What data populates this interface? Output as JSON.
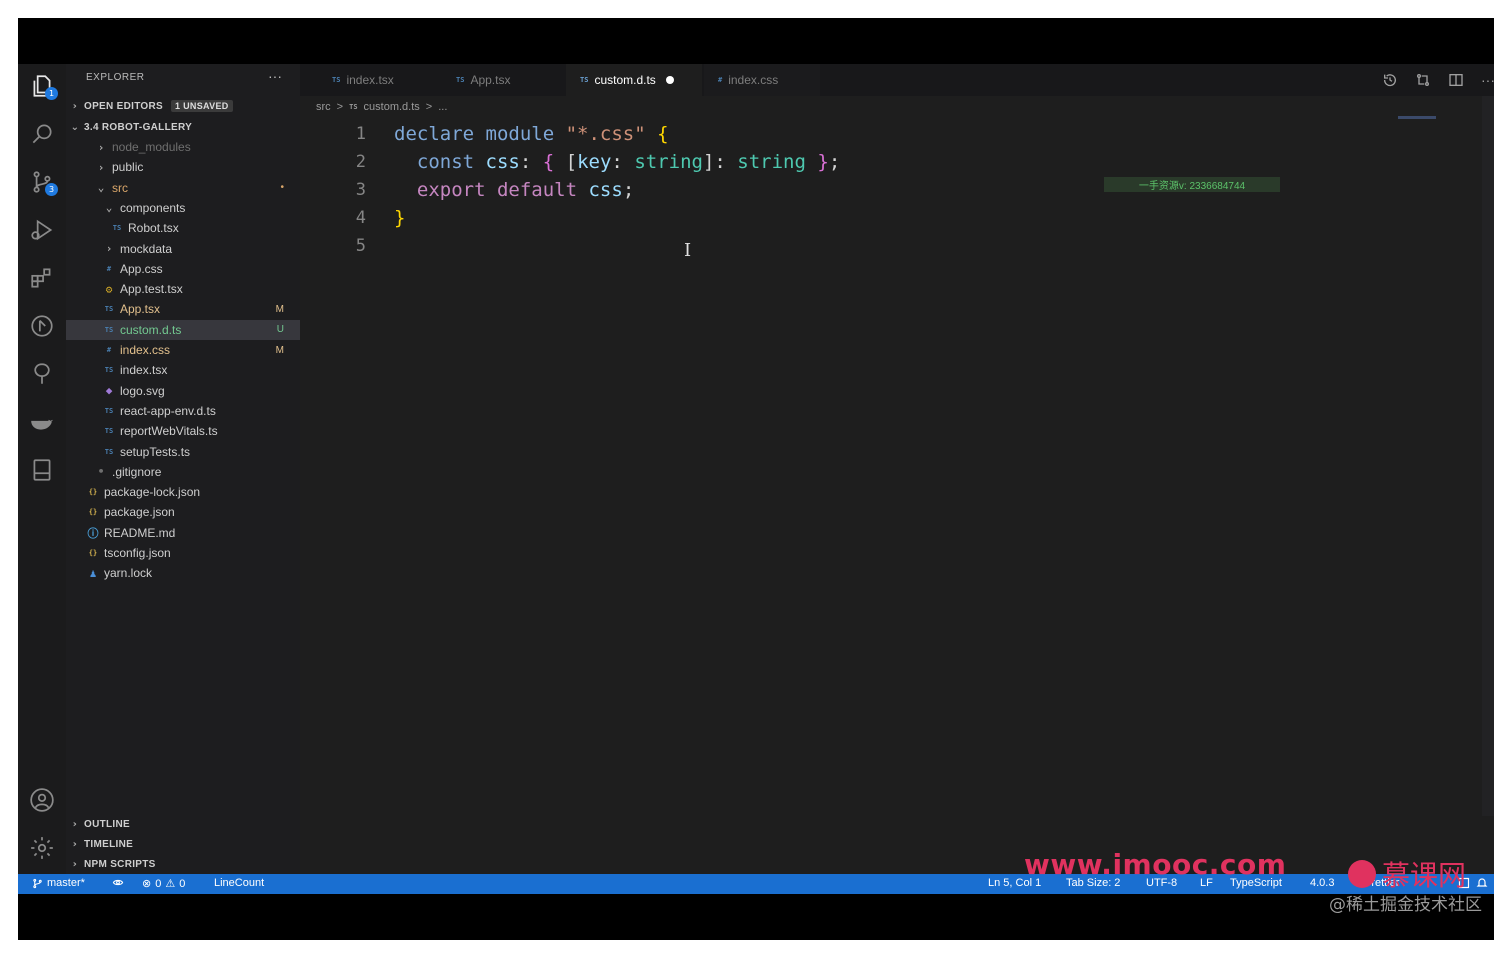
{
  "sidebar": {
    "title": "EXPLORER",
    "more": "···",
    "open_editors": {
      "label": "OPEN EDITORS",
      "badge": "1 UNSAVED"
    },
    "project": {
      "label": "3.4 ROBOT-GALLERY"
    },
    "tree": [
      {
        "name": "node_modules",
        "icon": "›",
        "color": "#6f6f6f"
      },
      {
        "name": "public",
        "icon": "›",
        "color": "#cfcfcf"
      },
      {
        "name": "src",
        "icon": "⌄",
        "color": "#d9a66a",
        "status": "•"
      },
      {
        "name": "components",
        "icon": "⌄",
        "color": "#cfcfcf"
      },
      {
        "name": "Robot.tsx",
        "icon": "TS",
        "color": "#cfcfcf"
      },
      {
        "name": "mockdata",
        "icon": "›",
        "color": "#cfcfcf"
      },
      {
        "name": "App.css",
        "icon": "#",
        "color": "#cfcfcf"
      },
      {
        "name": "App.test.tsx",
        "icon": "⚙",
        "color": "#cfcfcf"
      },
      {
        "name": "App.tsx",
        "icon": "TS",
        "color": "#e2c08d",
        "status": "M"
      },
      {
        "name": "custom.d.ts",
        "icon": "TS",
        "color": "#73c991",
        "status": "U"
      },
      {
        "name": "index.css",
        "icon": "#",
        "color": "#e2c08d",
        "status": "M"
      },
      {
        "name": "index.tsx",
        "icon": "TS",
        "color": "#cfcfcf"
      },
      {
        "name": "logo.svg",
        "icon": "◆",
        "color": "#cfcfcf"
      },
      {
        "name": "react-app-env.d.ts",
        "icon": "TS",
        "color": "#cfcfcf"
      },
      {
        "name": "reportWebVitals.ts",
        "icon": "TS",
        "color": "#cfcfcf"
      },
      {
        "name": "setupTests.ts",
        "icon": "TS",
        "color": "#cfcfcf"
      },
      {
        "name": ".gitignore",
        "icon": "•",
        "color": "#cfcfcf"
      },
      {
        "name": "package-lock.json",
        "icon": "{}",
        "color": "#cfcfcf"
      },
      {
        "name": "package.json",
        "icon": "{}",
        "color": "#cfcfcf"
      },
      {
        "name": "README.md",
        "icon": "ⓘ",
        "color": "#cfcfcf"
      },
      {
        "name": "tsconfig.json",
        "icon": "{}",
        "color": "#cfcfcf"
      },
      {
        "name": "yarn.lock",
        "icon": "♟",
        "color": "#cfcfcf"
      }
    ],
    "outline": "OUTLINE",
    "timeline": "TIMELINE",
    "npm_scripts": "NPM SCRIPTS"
  },
  "tabs": [
    {
      "icon": "TS",
      "label": "index.tsx"
    },
    {
      "icon": "TS",
      "label": "App.tsx"
    },
    {
      "icon": "TS",
      "label": "custom.d.ts"
    },
    {
      "icon": "#",
      "label": "index.css"
    }
  ],
  "breadcrumb": {
    "folder": "src",
    "sep1": ">",
    "file_icon": "TS",
    "file": "custom.d.ts",
    "sep2": ">",
    "more": "..."
  },
  "editor": {
    "line_numbers": [
      "1",
      "2",
      "3",
      "4",
      "5"
    ],
    "inline_watermark": "一手资源v: 2336684744",
    "cursor": "I"
  },
  "statusbar": {
    "branch": "master*",
    "errors": "0",
    "warnings": "0",
    "linecount": "LineCount",
    "position": "Ln 5, Col 1",
    "tab_size": "Tab Size: 2",
    "encoding": "UTF-8",
    "eol": "LF",
    "language": "TypeScript",
    "ts_version": "4.0.3",
    "prettier": "Prettier"
  },
  "overlay": {
    "site": "www.imooc.com",
    "brand": "慕课网",
    "community": "@稀土掘金技术社区"
  },
  "colors": {
    "accent": "#1a6fd1",
    "editor_bg": "#1e1e1e",
    "imooc_red": "#e0325f"
  }
}
